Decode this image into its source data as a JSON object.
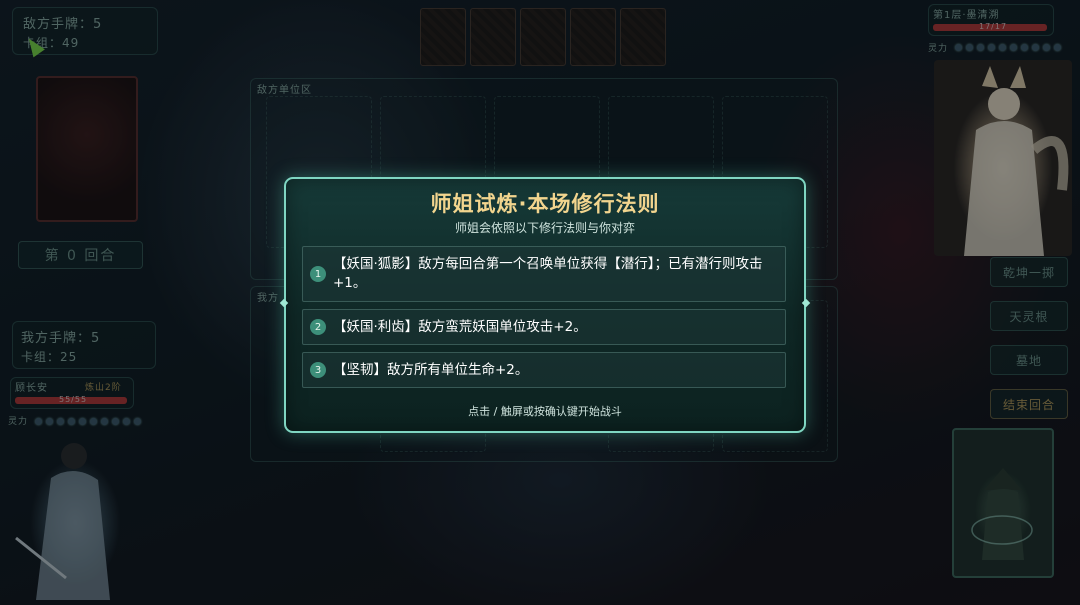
{
  "enemy": {
    "hand_label": "敌方手牌：5",
    "deck_label": "卡组：49",
    "zone_label": "敌方单位区",
    "floor_label": "第1层·墨清溯",
    "hp_text": "17/17",
    "hp_fraction": 1.0,
    "spirit_label": "灵力"
  },
  "player": {
    "hand_label": "我方手牌：5",
    "deck_label": "卡组：25",
    "zone_label": "我方",
    "name": "顾长安",
    "realm": "炼山2阶",
    "hp_text": "55/55",
    "hp_fraction": 1.0,
    "spirit_label": "灵力"
  },
  "turn_label": "第 0 回合",
  "side_buttons": [
    "乾坤一掷",
    "天灵根",
    "墓地",
    "结束回合"
  ],
  "modal": {
    "title": "师姐试炼·本场修行法则",
    "subtitle": "师姐会依照以下修行法则与你对弈",
    "rules": [
      {
        "num": "1",
        "text": "【妖国·狐影】敌方每回合第一个召唤单位获得【潜行】；已有潜行则攻击+1。"
      },
      {
        "num": "2",
        "text": "【妖国·利齿】敌方蛮荒妖国单位攻击+2。"
      },
      {
        "num": "3",
        "text": "【坚韧】敌方所有单位生命+2。"
      }
    ],
    "footer": "点击 / 触屏或按确认键开始战斗"
  },
  "colors": {
    "accent": "#7fd6c2",
    "title_gold": "#f2d58e",
    "rule_number": "#3d8f7a"
  }
}
